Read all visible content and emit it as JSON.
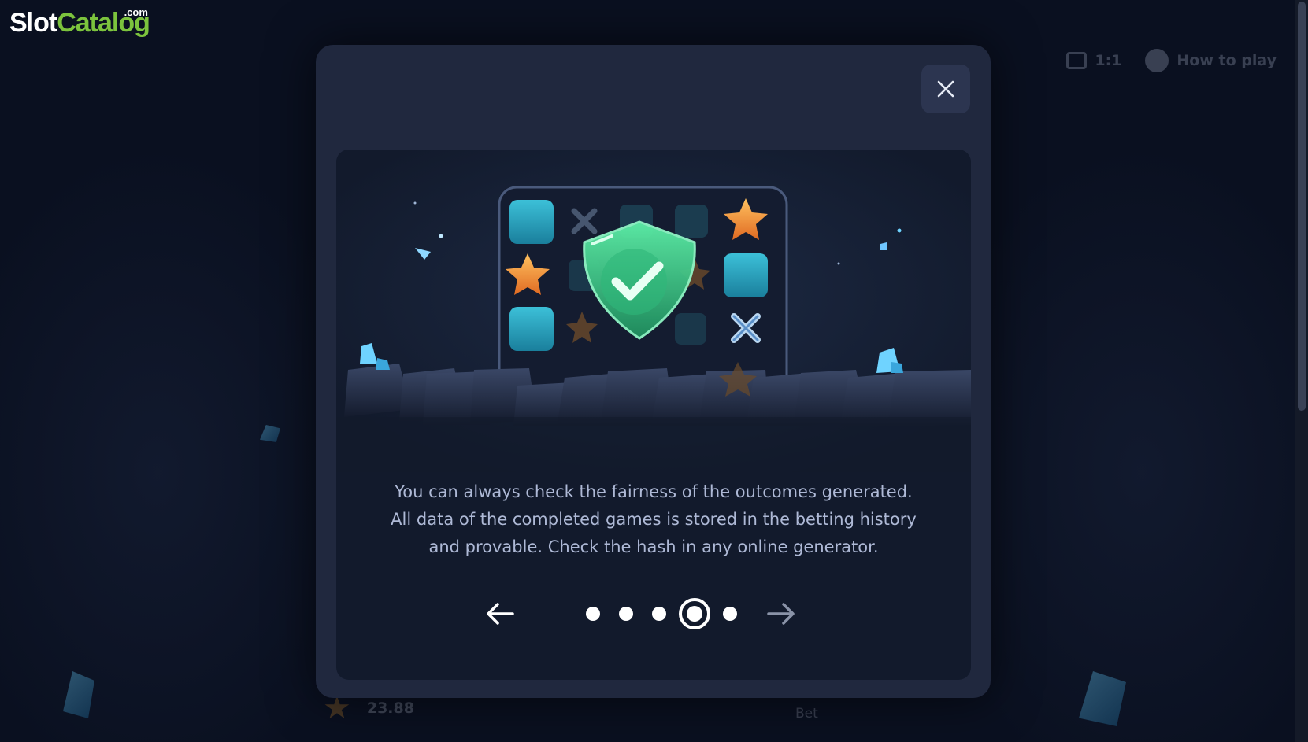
{
  "logo": {
    "part1": "Slot",
    "part2": "Catalog",
    "suffix": ".com"
  },
  "background": {
    "topbar": {
      "counter": "1:1",
      "help_label": "How to play"
    },
    "bottom": {
      "balance": "23.88",
      "bet_label": "Bet"
    }
  },
  "modal": {
    "close_icon": "close-icon",
    "description": "You can always check the fairness of the outcomes generated. All data of the completed games is stored in the betting history and provable. Check the hash in any online generator.",
    "pager": {
      "total_pages": 5,
      "current_page": 4,
      "prev_icon": "arrow-left-icon",
      "next_icon": "arrow-right-icon"
    }
  },
  "colors": {
    "modal_bg": "#20283e",
    "body_bg": "#121a2c",
    "text": "#aeb9d6",
    "logo_green": "#7cc33d",
    "shield_green": "#3ecf8e",
    "star_orange": "#f29a2e",
    "tile_teal": "#2aa7c6"
  }
}
